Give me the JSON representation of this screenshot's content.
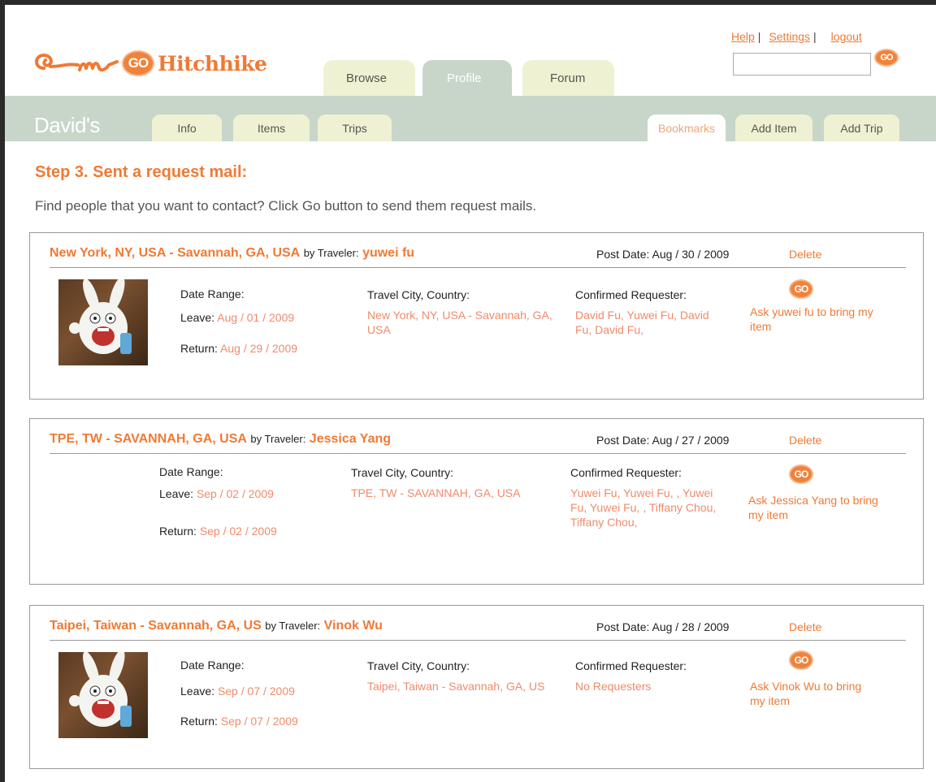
{
  "header": {
    "logo_text": "Hitchhike",
    "logo_badge": "GO",
    "links": {
      "help": "Help",
      "settings": "Settings",
      "logout": "logout",
      "sep": "|"
    },
    "search": {
      "value": "",
      "go_label": "GO"
    }
  },
  "main_tabs": {
    "browse": "Browse",
    "profile": "Profile",
    "forum": "Forum"
  },
  "profile": {
    "owner": "David's",
    "tabs": {
      "info": "Info",
      "items": "Items",
      "trips": "Trips",
      "bookmarks": "Bookmarks",
      "add_item": "Add Item",
      "add_trip": "Add Trip"
    }
  },
  "step": {
    "title": "Step 3. Sent a request mail:",
    "description": "Find people that you want to contact? Click Go button to send them request mails."
  },
  "labels": {
    "by_traveler": "by Traveler:",
    "post_date": "Post Date:",
    "delete": "Delete",
    "date_range": "Date Range:",
    "leave": "Leave:",
    "return": "Return:",
    "travel_city": "Travel City, Country:",
    "confirmed_requester": "Confirmed Requester:",
    "go": "GO"
  },
  "trips": [
    {
      "route": "New York, NY, USA - Savannah, GA, USA",
      "traveler": "yuwei fu",
      "post_date": "Aug / 30 / 2009",
      "leave": "Aug / 01 / 2009",
      "return": "Aug / 29 / 2009",
      "travel_city": "New York, NY, USA - Savannah, GA, USA",
      "requesters": "David Fu, Yuwei Fu, David Fu, David Fu,",
      "ask_text": "Ask yuwei fu to bring my item",
      "has_avatar": true
    },
    {
      "route": "TPE, TW - SAVANNAH, GA, USA",
      "traveler": "Jessica Yang",
      "post_date": "Aug / 27 / 2009",
      "leave": "Sep / 02 / 2009",
      "return": "Sep / 02 / 2009",
      "travel_city": "TPE, TW - SAVANNAH, GA, USA",
      "requesters": "Yuwei Fu, Yuwei Fu, , Yuwei Fu, Yuwei Fu, , Tiffany Chou, Tiffany Chou,",
      "ask_text": "Ask Jessica Yang to bring my item",
      "has_avatar": false
    },
    {
      "route": "Taipei, Taiwan - Savannah, GA, US",
      "traveler": "Vinok Wu",
      "post_date": "Aug / 28 / 2009",
      "leave": "Sep / 07 / 2009",
      "return": "Sep / 07 / 2009",
      "travel_city": "Taipei, Taiwan - Savannah, GA, US",
      "requesters": "No Requesters",
      "ask_text": "Ask Vinok Wu to bring my item",
      "has_avatar": true
    }
  ],
  "colors": {
    "accent": "#ef7a34",
    "link_value": "#ef8a6a",
    "tab_green": "#c7d6c9",
    "tab_cream": "#eff2d2"
  }
}
